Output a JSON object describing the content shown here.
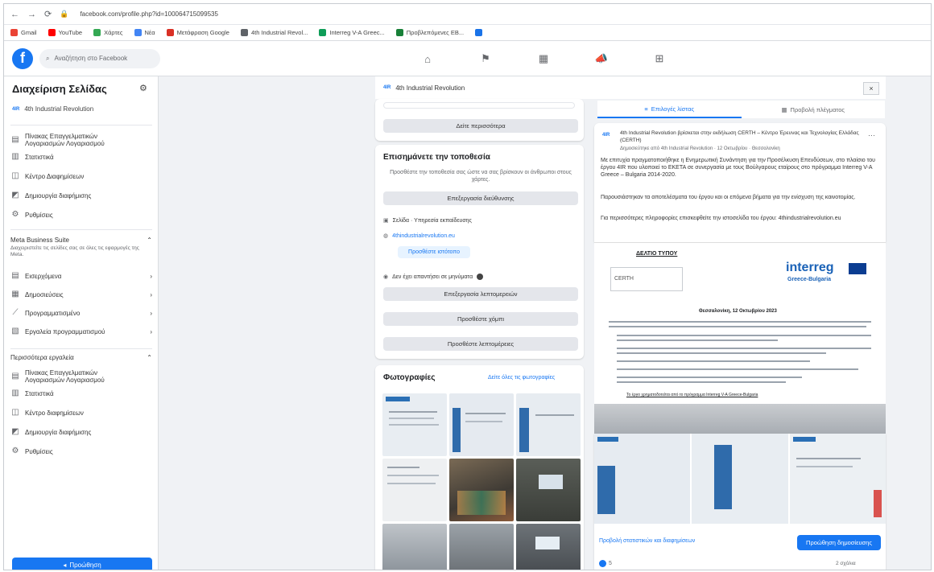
{
  "browser": {
    "url": "facebook.com/profile.php?id=100064715099535",
    "bookmarks": [
      {
        "label": "Gmail",
        "color": "#ea4335"
      },
      {
        "label": "YouTube",
        "color": "#ff0000"
      },
      {
        "label": "Χάρτες",
        "color": "#34a853"
      },
      {
        "label": "Νέα",
        "color": "#4285f4"
      },
      {
        "label": "Μετάφραση Google",
        "color": "#d93025"
      },
      {
        "label": "4th Industrial Revol...",
        "color": "#5f6368"
      },
      {
        "label": "Interreg V-A Greec...",
        "color": "#0f9d58"
      },
      {
        "label": "Προβλεπόμενες ΕΒ...",
        "color": "#188038"
      },
      {
        "label": "",
        "color": "#1a73e8"
      }
    ]
  },
  "fb": {
    "logo": "f",
    "search_placeholder": "Αναζήτηση στο Facebook",
    "nav_icons": [
      "home-icon",
      "flag-icon",
      "marketplace-icon",
      "megaphone-icon",
      "groups-icon"
    ]
  },
  "sidebar": {
    "title": "Διαχείριση Σελίδας",
    "page_name": "4th Industrial Revolution",
    "mini_logo": "4IR",
    "items_top": [
      {
        "icon": "inbox-icon",
        "label": "Πίνακας Επαγγελματικών Λογαριασμών Λογαριασμού"
      },
      {
        "icon": "stats-icon",
        "label": "Στατιστικά"
      },
      {
        "icon": "ads-icon",
        "label": "Κέντρο Διαφημίσεων"
      },
      {
        "icon": "create-ad-icon",
        "label": "Δημιουργία διαφήμισης"
      },
      {
        "icon": "settings-icon",
        "label": "Ρυθμίσεις"
      }
    ],
    "meta_section": "Meta Business Suite",
    "meta_desc": "Διαχειριστείτε τις σελίδες σας σε όλες τις εφαρμογές της Meta.",
    "meta_items": [
      {
        "icon": "inbox-icon",
        "label": "Εισερχόμενα"
      },
      {
        "icon": "calendar-icon",
        "label": "Δημοσιεύσεις"
      },
      {
        "icon": "chart-icon",
        "label": "Προγραμματισμένο"
      },
      {
        "icon": "schedule-icon",
        "label": "Εργαλεία προγραμματισμού"
      }
    ],
    "ads_section": "Περισσότερα εργαλεία",
    "ads_items": [
      {
        "icon": "inbox-icon",
        "label": "Πίνακας Επαγγελματικών Λογαριασμών Λογαριασμού"
      },
      {
        "icon": "stats-icon",
        "label": "Στατιστικά"
      },
      {
        "icon": "ads-icon",
        "label": "Κέντρο διαφημίσεων"
      },
      {
        "icon": "create-ad-icon",
        "label": "Δημιουργία διαφήμισης"
      },
      {
        "icon": "settings-icon",
        "label": "Ρυθμίσεις"
      }
    ],
    "promote_label": "Προώθηση"
  },
  "page_header": {
    "mini_logo": "4IR",
    "name": "4th Industrial Revolution",
    "close": "×"
  },
  "middle": {
    "top_button": "Δείτε περισσότερα",
    "map_card": {
      "title": "Επισημάνετε την τοποθεσία",
      "text": "Προσθέστε την τοποθεσία σας ώστε να σας βρίσκουν οι άνθρωποι στους χάρτες.",
      "button": "Επεξεργασία διεύθυνσης",
      "row1": "Σελίδα · Υπηρεσία εκπαίδευσης",
      "row2_link": "4thindustrialrevolution.eu",
      "small_btn": "Προσθέστε ιστότοπο",
      "row3": "Δεν έχει απαντήσει σε μηνύματα",
      "btn2": "Επεξεργασία λεπτομερειών",
      "btn3": "Προσθέστε χόμπι",
      "btn4": "Προσθέστε λεπτομέρειες"
    },
    "photos": {
      "title": "Φωτογραφίες",
      "see_all": "Δείτε όλες τις φωτογραφίες"
    }
  },
  "right": {
    "tabs": [
      {
        "label": "Επιλογές λίστας",
        "active": true
      },
      {
        "label": "Προβολή πλέγματος",
        "active": false
      }
    ],
    "post": {
      "author_line": "4th Industrial Revolution βρίσκεται στην εκδήλωση CERTH – Κέντρο Έρευνας και Τεχνολογίας Ελλάδας (CERTH)",
      "meta": "Δημοσιεύτηκε από 4th Industrial Revolution · 12 Οκτωβρίου · Θεσσαλονίκη",
      "para1": "Με επιτυχία πραγματοποιήθηκε η Ενημερωτική Συνάντηση για την Προσέλκυση Επενδύσεων, στο πλαίσιο του έργου 4IR που υλοποιεί το ΕΚΕΤΑ σε συνεργασία με τους Βούλγαρους εταίρους στο πρόγραμμα Interreg V-A Greece – Bulgaria 2014-2020.",
      "para2": "Παρουσιάστηκαν τα αποτελέσματα του έργου και οι επόμενα βήματα για την ενίσχυση της καινοτομίας.",
      "para3": "Για περισσότερες πληροφορίες επισκεφθείτε την ιστοσελίδα του έργου: 4thindustrialrevolution.eu",
      "doc_heading": "ΔΕΛΤΙΟ ΤΥΠΟΥ",
      "doc_date": "Θεσσαλονίκη, 12 Οκτωβρίου 2023",
      "doc_footer": "Το έργο χρηματοδοτείται από το πρόγραμμα Interreg V-A Greece-Bulgaria",
      "interreg_title": "interreg",
      "interreg_sub": "Greece-Bulgaria",
      "promote_link": "Προβολή στατιστικών και διαφημίσεων",
      "boost_btn": "Προώθηση δημοσίευσης",
      "reactions": "5",
      "comments_label": "2 σχόλια"
    }
  },
  "colors": {
    "fb_blue": "#1877f2",
    "bg": "#f0f2f5"
  }
}
